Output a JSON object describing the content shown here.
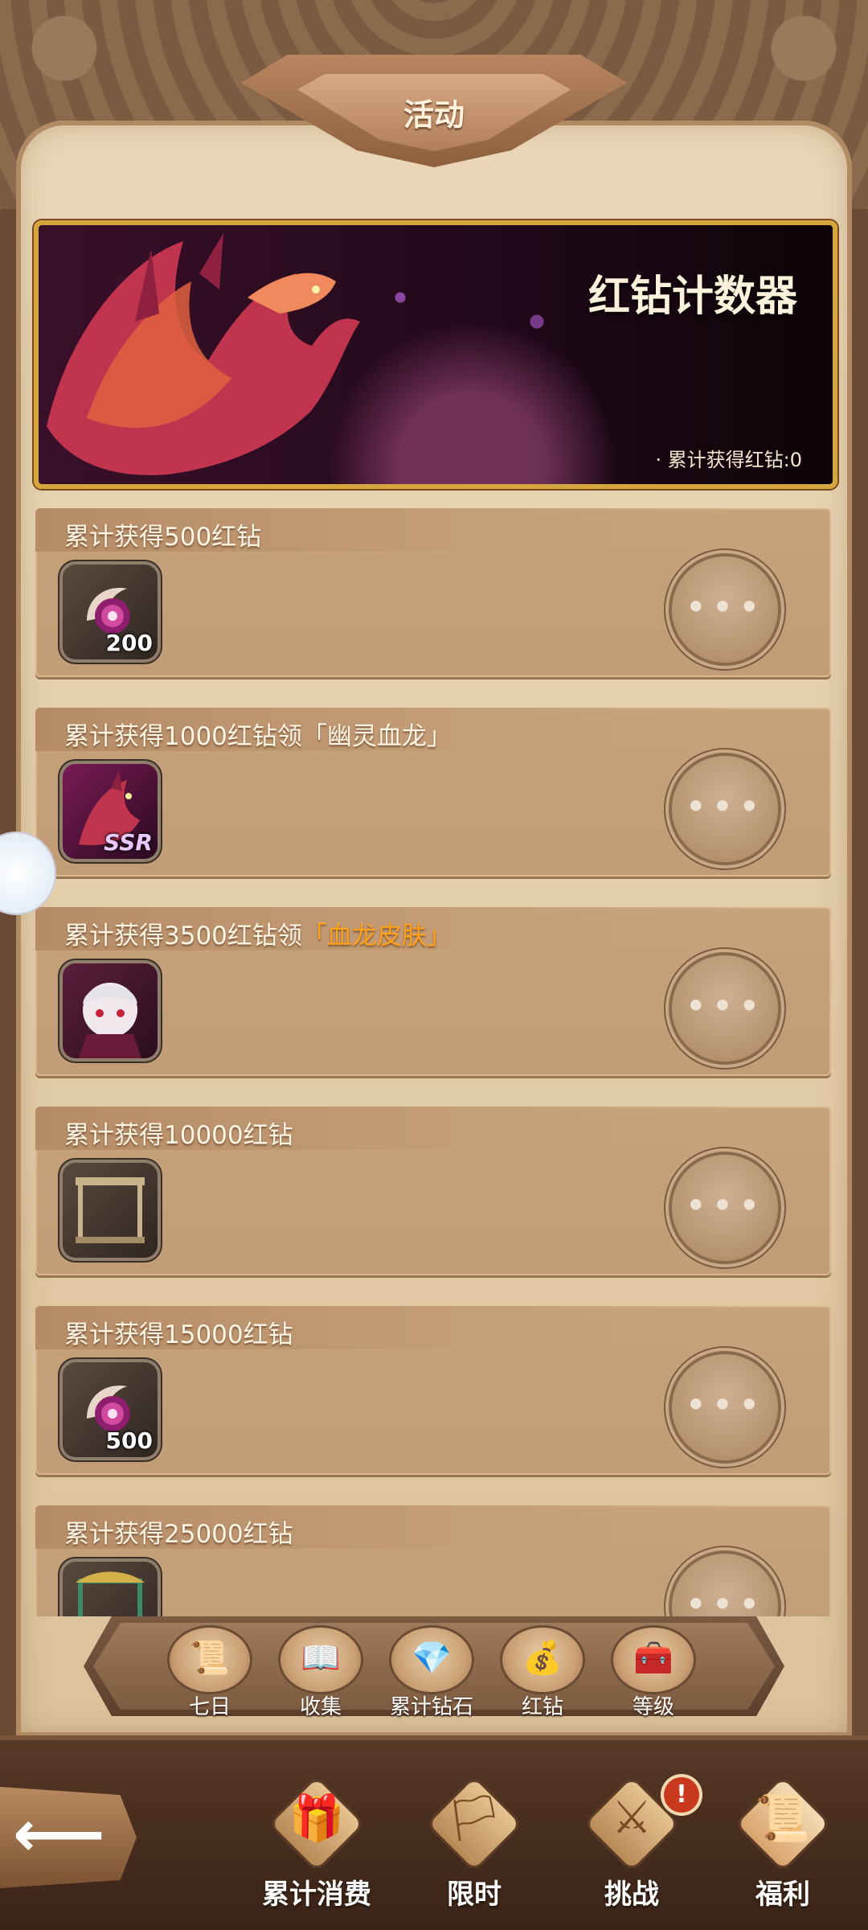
{
  "header": {
    "title": "活动"
  },
  "banner": {
    "title": "红钻计数器",
    "counter": "· 累计获得红钻:0"
  },
  "rewards": [
    {
      "title": "累计获得500红钻",
      "highlight": "",
      "item": "red-diamond-icon",
      "qty": "200"
    },
    {
      "title": "累计获得1000红钻领「幽灵血龙」",
      "highlight": "",
      "item": "ghost-blood-dragon-portrait",
      "qty": "",
      "tag": "SSR"
    },
    {
      "title": "累计获得3500红钻领",
      "highlight": "「血龙皮肤」",
      "item": "blood-dragon-skin-portrait",
      "qty": ""
    },
    {
      "title": "累计获得10000红钻",
      "highlight": "",
      "item": "frame-icon",
      "qty": ""
    },
    {
      "title": "累计获得15000红钻",
      "highlight": "",
      "item": "red-diamond-icon",
      "qty": "500"
    },
    {
      "title": "累计获得25000红钻",
      "highlight": "",
      "item": "ornate-frame-icon",
      "qty": ""
    }
  ],
  "more_button": {
    "label": "•••"
  },
  "tabs": [
    {
      "label": "七日",
      "icon": "scroll-icon"
    },
    {
      "label": "收集",
      "icon": "book-icon"
    },
    {
      "label": "累计钻石",
      "icon": "gem-bag-icon"
    },
    {
      "label": "红钻",
      "icon": "money-bag-icon"
    },
    {
      "label": "等级",
      "icon": "chest-icon"
    }
  ],
  "bottom_nav": [
    {
      "label": "累计消费",
      "icon": "gift-box-icon"
    },
    {
      "label": "限时",
      "icon": "banner-flag-icon"
    },
    {
      "label": "挑战",
      "icon": "sword-icon",
      "badge": "!"
    },
    {
      "label": "福利",
      "icon": "scroll-card-icon"
    }
  ],
  "colors": {
    "accent": "#ffa21a",
    "gold_border": "#d6a63e",
    "parchment": "#e2cba7"
  }
}
